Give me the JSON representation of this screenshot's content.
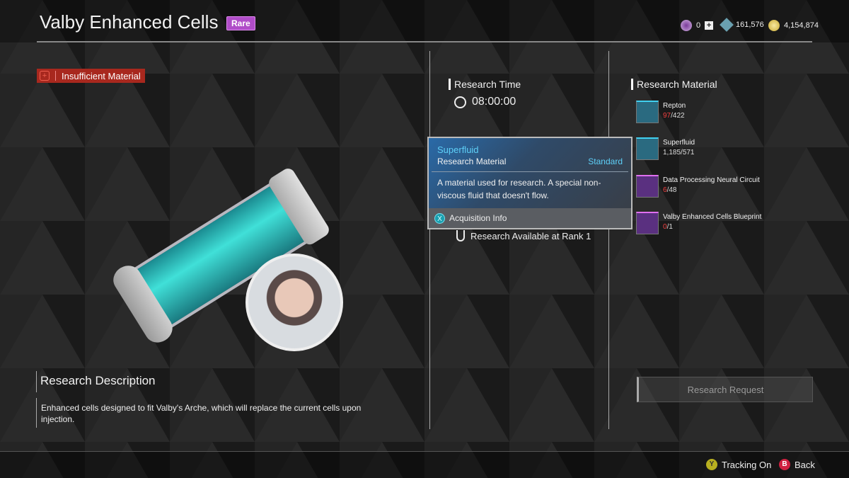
{
  "header": {
    "title": "Valby Enhanced Cells",
    "rarity": "Rare",
    "rarity_color": "#b04cc8"
  },
  "currencies": [
    {
      "icon": "premium-token-icon",
      "value": "0",
      "add_label": "+"
    },
    {
      "icon": "crystal-icon",
      "value": "161,576"
    },
    {
      "icon": "gold-coin-icon",
      "value": "4,154,874"
    }
  ],
  "status": {
    "label": "Insufficient Material",
    "icon": "warning-hex-icon",
    "color": "#a8281e"
  },
  "research_time": {
    "heading": "Research Time",
    "value": "08:00:00"
  },
  "rank": {
    "label": "Research Available at Rank 1"
  },
  "materials": {
    "heading": "Research Material",
    "items": [
      {
        "name": "Repton",
        "have": "97",
        "need": "422",
        "sufficient": false
      },
      {
        "name": "Superfluid",
        "have": "1,185",
        "need": "571",
        "sufficient": true
      },
      {
        "name": "Data Processing Neural Circuit",
        "have": "6",
        "need": "48",
        "sufficient": false
      },
      {
        "name": "Valby Enhanced Cells Blueprint",
        "have": "0",
        "need": "1",
        "sufficient": false
      }
    ]
  },
  "tooltip": {
    "name": "Superfluid",
    "type": "Research Material",
    "grade": "Standard",
    "description": "A material used for research. A special non-viscous fluid that doesn't flow.",
    "footer_button": "X",
    "footer_label": "Acquisition Info"
  },
  "description": {
    "heading": "Research Description",
    "text": "Enhanced cells designed to fit Valby's Arche, which will replace the current cells upon injection."
  },
  "request_button": "Research Request",
  "hints": [
    {
      "button": "Y",
      "label": "Tracking On",
      "color": "#b8b020"
    },
    {
      "button": "B",
      "label": "Back",
      "color": "#d02040"
    }
  ]
}
